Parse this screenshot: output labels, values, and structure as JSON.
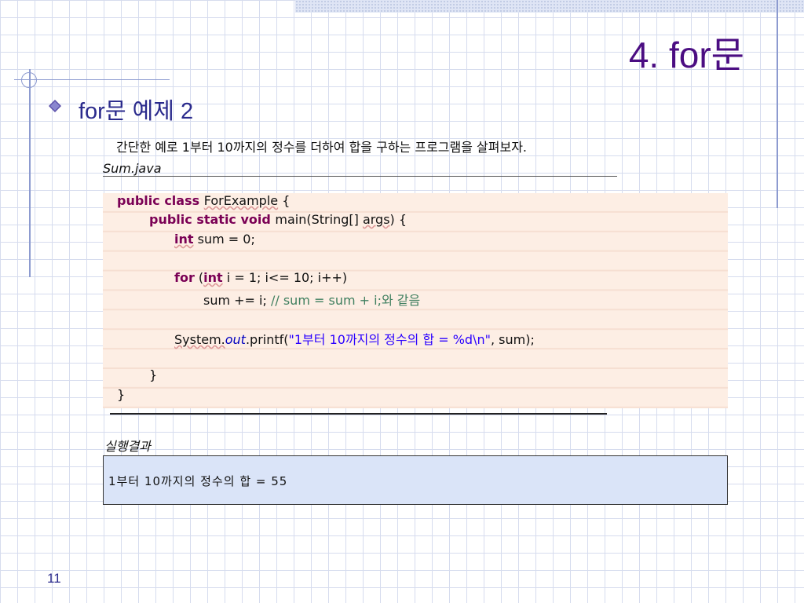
{
  "slide": {
    "title": "4. for문",
    "subtitle": "for문 예제 2",
    "intro": "간단한 예로 1부터 10까지의 정수를 더하여 합을 구하는 프로그램을 살펴보자.",
    "file_label": "Sum.java",
    "result_label": "실행결과",
    "page_number": "11"
  },
  "code": {
    "line1_kw": "public class ",
    "line1_name": "ForExample",
    "line1_rest": " {",
    "line2_kw": "public static void ",
    "line2_a": "main(String[] ",
    "line2_args": "args",
    "line2_b": ") {",
    "line3_kw": "int",
    "line3_rest": " sum = 0;",
    "line4_kw1": "for",
    "line4_a": " (",
    "line4_kw2": "int",
    "line4_b": " i = 1; i<= 10; i++)",
    "line5_code": "sum += i; ",
    "line5_comment": "// sum = sum + i;와 같음",
    "line6_a": "System.",
    "line6_out": "out",
    "line6_b": ".printf(",
    "line6_str": "\"1부터 10까지의 정수의 합 = %d\\n\"",
    "line6_c": ", sum);",
    "line7": "}",
    "line8": "}"
  },
  "result": {
    "output": "1부터 10까지의 정수의 합 = 55"
  },
  "colors": {
    "title": "#4b0d82",
    "subtitle": "#2a2a8c",
    "code_bg": "#fdeee4",
    "result_bg": "#dae4f8"
  }
}
